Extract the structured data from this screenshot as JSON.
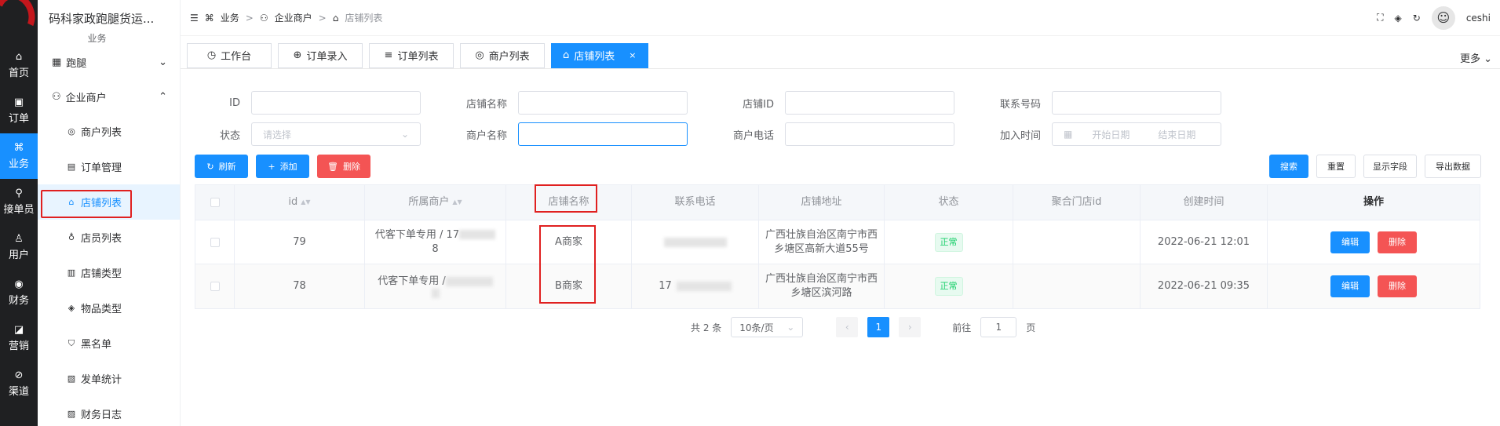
{
  "brand": {
    "title": "码科家政跑腿货运...",
    "sub": "业务"
  },
  "rail": [
    {
      "icon": "⌂",
      "label": "首页"
    },
    {
      "icon": "▣",
      "label": "订单"
    },
    {
      "icon": "⌘",
      "label": "业务"
    },
    {
      "icon": "⚲",
      "label": "接单员"
    },
    {
      "icon": "♙",
      "label": "用户"
    },
    {
      "icon": "◉",
      "label": "财务"
    },
    {
      "icon": "◪",
      "label": "营销"
    },
    {
      "icon": "⊘",
      "label": "渠道"
    }
  ],
  "submenu": {
    "group1": "跑腿",
    "group2": "企业商户",
    "items": [
      "商户列表",
      "订单管理",
      "店铺列表",
      "店员列表",
      "店铺类型",
      "物品类型",
      "黑名单",
      "发单统计",
      "财务日志"
    ]
  },
  "breadcrumb": {
    "first": "业务",
    "second": "企业商户",
    "current": "店铺列表"
  },
  "header": {
    "user": "ceshi"
  },
  "tabs": [
    "工作台",
    "订单录入",
    "订单列表",
    "商户列表",
    "店铺列表"
  ],
  "more": "更多",
  "filters": {
    "id": "ID",
    "shop_name": "店铺名称",
    "shop_id": "店铺ID",
    "phone": "联系号码",
    "status": "状态",
    "status_placeholder": "请选择",
    "merchant_name": "商户名称",
    "merchant_phone": "商户电话",
    "join_time": "加入时间",
    "start_date": "开始日期",
    "end_date": "结束日期"
  },
  "actions": {
    "refresh": "刷新",
    "add": "添加",
    "delete": "删除",
    "search": "搜索",
    "reset": "重置",
    "fields": "显示字段",
    "export": "导出数据"
  },
  "table": {
    "headers": [
      "id",
      "所属商户",
      "店铺名称",
      "联系电话",
      "店铺地址",
      "状态",
      "聚合门店id",
      "创建时间",
      "操作"
    ],
    "rows": [
      {
        "id": "79",
        "merchant_a": "代客下单专用 / 17",
        "merchant_b": "8",
        "shop": "A商家",
        "phone": "",
        "addr": "广西壮族自治区南宁市西乡塘区高新大道55号",
        "status": "正常",
        "agg": "",
        "created": "2022-06-21 12:01",
        "edit": "编辑",
        "del": "删除"
      },
      {
        "id": "78",
        "merchant_a": "代客下单专用 /",
        "merchant_b": "",
        "shop": "B商家",
        "phone": "17",
        "addr": "广西壮族自治区南宁市西乡塘区滨河路",
        "status": "正常",
        "agg": "",
        "created": "2022-06-21 09:35",
        "edit": "编辑",
        "del": "删除"
      }
    ]
  },
  "pager": {
    "total": "共 2 条",
    "size": "10条/页",
    "page": "1",
    "goto": "前往",
    "goto_value": "1",
    "unit": "页"
  },
  "colors": {
    "primary": "#1890ff",
    "danger": "#f45454",
    "highlight": "#e02020",
    "rail": "#1f2022"
  }
}
